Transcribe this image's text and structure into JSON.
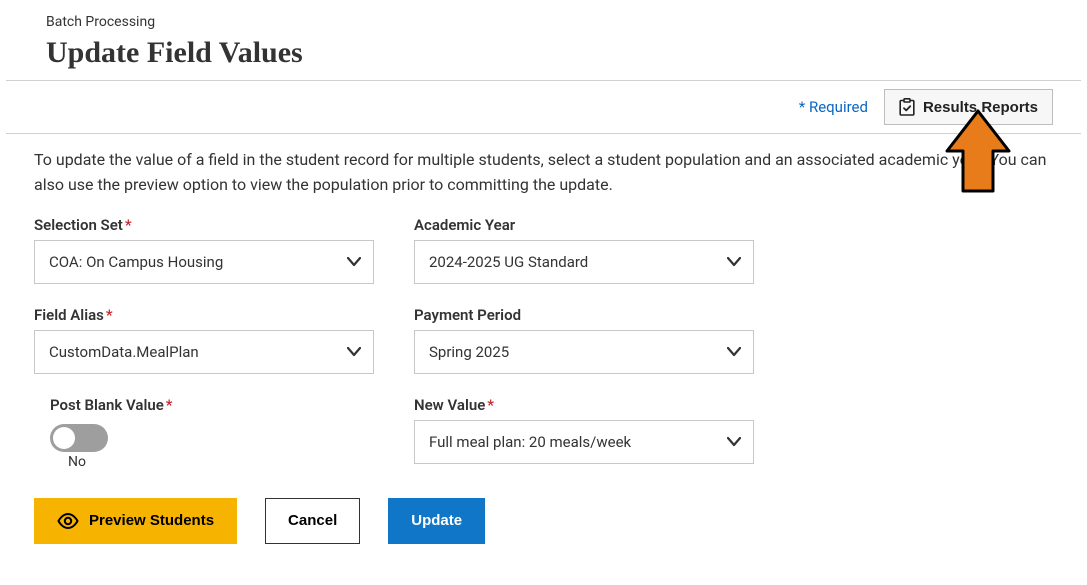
{
  "header": {
    "breadcrumb": "Batch Processing",
    "title": "Update Field Values"
  },
  "topbar": {
    "required_note": "* Required",
    "results_reports_label": "Results Reports"
  },
  "description": "To update the value of a field in the student record for multiple students, select a student population and an associated academic year. You can also use the preview option to view the population prior to committing the update.",
  "form": {
    "selection_set": {
      "label": "Selection Set",
      "value": "COA: On Campus Housing"
    },
    "academic_year": {
      "label": "Academic Year",
      "value": "2024-2025 UG Standard"
    },
    "field_alias": {
      "label": "Field Alias",
      "value": "CustomData.MealPlan"
    },
    "payment_period": {
      "label": "Payment Period",
      "value": "Spring 2025"
    },
    "post_blank": {
      "label": "Post Blank Value",
      "state_text": "No"
    },
    "new_value": {
      "label": "New Value",
      "value": "Full meal plan: 20 meals/week"
    }
  },
  "actions": {
    "preview": "Preview Students",
    "cancel": "Cancel",
    "update": "Update"
  }
}
